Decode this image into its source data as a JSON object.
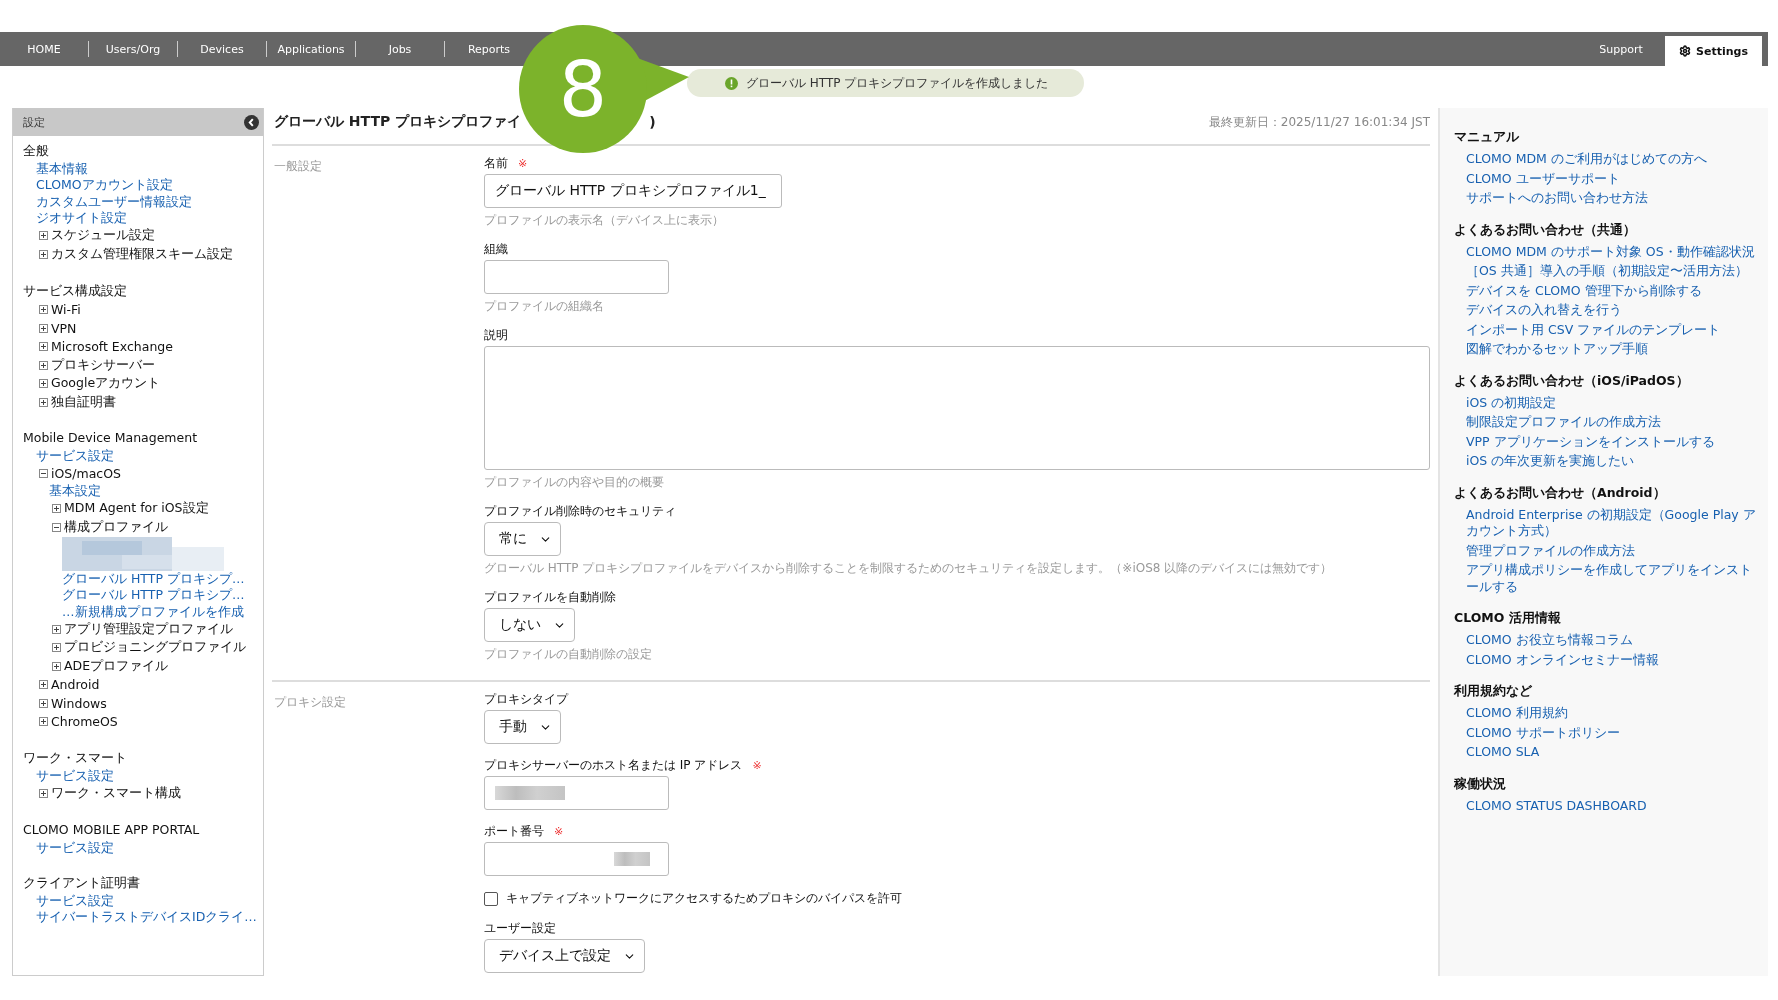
{
  "nav": {
    "tabs": [
      {
        "label": "HOME",
        "selected": false
      },
      {
        "label": "Users/Org",
        "selected": false
      },
      {
        "label": "Devices",
        "selected": false
      },
      {
        "label": "Applications",
        "selected": false
      },
      {
        "label": "Jobs",
        "selected": false
      },
      {
        "label": "Reports",
        "selected": false
      }
    ],
    "right_tabs": [
      {
        "label": "Support",
        "selected": false,
        "kind": "plain"
      },
      {
        "label": "Settings",
        "selected": true,
        "kind": "gear"
      }
    ]
  },
  "step_badge": "8",
  "notification": {
    "kind": "success",
    "text": "グローバル HTTP プロキシプロファイルを作成しました"
  },
  "sidebar": {
    "title": "設定",
    "sections": [
      {
        "heading": "全般",
        "items": [
          {
            "kind": "link",
            "label": "基本情報"
          },
          {
            "kind": "link",
            "label": "CLOMOアカウント設定"
          },
          {
            "kind": "link",
            "label": "カスタムユーザー情報設定"
          },
          {
            "kind": "link",
            "label": "ジオサイト設定"
          },
          {
            "kind": "node",
            "label": "スケジュール設定",
            "expanded": false
          },
          {
            "kind": "node",
            "label": "カスタム管理権限スキーム設定",
            "expanded": false
          }
        ]
      },
      {
        "heading": "サービス構成設定",
        "items": [
          {
            "kind": "node",
            "label": "Wi-Fi",
            "expanded": false
          },
          {
            "kind": "node",
            "label": "VPN",
            "expanded": false
          },
          {
            "kind": "node",
            "label": "Microsoft Exchange",
            "expanded": false
          },
          {
            "kind": "node",
            "label": "プロキシサーバー",
            "expanded": false
          },
          {
            "kind": "node",
            "label": "Googleアカウント",
            "expanded": false
          },
          {
            "kind": "node",
            "label": "独自証明書",
            "expanded": false
          }
        ]
      },
      {
        "heading": "Mobile Device Management",
        "items": [
          {
            "kind": "link",
            "label": "サービス設定"
          },
          {
            "kind": "node",
            "label": "iOS/macOS",
            "expanded": true,
            "children": [
              {
                "kind": "link",
                "label": "基本設定"
              },
              {
                "kind": "node",
                "label": "MDM Agent for iOS設定",
                "expanded": false
              },
              {
                "kind": "node",
                "label": "構成プロファイル",
                "expanded": true,
                "children": [
                  {
                    "kind": "blurred"
                  },
                  {
                    "kind": "link",
                    "label": "グローバル HTTP プロキシプ…"
                  },
                  {
                    "kind": "link",
                    "label": "グローバル HTTP プロキシプ…"
                  },
                  {
                    "kind": "link",
                    "label": "…新規構成プロファイルを作成"
                  }
                ]
              },
              {
                "kind": "node",
                "label": "アプリ管理設定プロファイル",
                "expanded": false
              },
              {
                "kind": "node",
                "label": "プロビジョニングプロファイル",
                "expanded": false
              },
              {
                "kind": "node",
                "label": "ADEプロファイル",
                "expanded": false
              }
            ]
          },
          {
            "kind": "node",
            "label": "Android",
            "expanded": false
          },
          {
            "kind": "node",
            "label": "Windows",
            "expanded": false
          },
          {
            "kind": "node",
            "label": "ChromeOS",
            "expanded": false
          }
        ]
      },
      {
        "heading": "ワーク・スマート",
        "items": [
          {
            "kind": "link",
            "label": "サービス設定"
          },
          {
            "kind": "node",
            "label": "ワーク・スマート構成",
            "expanded": false
          }
        ]
      },
      {
        "heading": "CLOMO MOBILE APP PORTAL",
        "items": [
          {
            "kind": "link",
            "label": "サービス設定"
          }
        ]
      },
      {
        "heading": "クライアント証明書",
        "items": [
          {
            "kind": "link",
            "label": "サービス設定"
          },
          {
            "kind": "link",
            "label": "サイバートラストデバイスIDクライ…"
          }
        ]
      }
    ]
  },
  "main": {
    "title": "グローバル HTTP プロキシプロファイ",
    "title_end": ")",
    "last_updated": "最終更新日：2025/11/27 16:01:34 JST",
    "sections": [
      {
        "label": "一般設定",
        "fields": [
          {
            "kind": "text",
            "label": "名前",
            "required_mark": "※",
            "value": "グローバル HTTP プロキシプロファイル1_",
            "hint": "プロファイルの表示名（デバイス上に表示）"
          },
          {
            "kind": "text",
            "label": "組織",
            "hint": "プロファイルの組織名"
          },
          {
            "kind": "textarea",
            "label": "説明",
            "hint": "プロファイルの内容や目的の概要"
          },
          {
            "kind": "select",
            "label": "プロファイル削除時のセキュリティ",
            "value": "常に",
            "hint": "グローバル HTTP プロキシプロファイルをデバイスから削除することを制限するためのセキュリティを設定します。（※iOS8 以降のデバイスには無効です）"
          },
          {
            "kind": "select",
            "label": "プロファイルを自動削除",
            "value": "しない",
            "hint": "プロファイルの自動削除の設定"
          }
        ]
      },
      {
        "label": "プロキシ設定",
        "fields": [
          {
            "kind": "select",
            "label": "プロキシタイプ",
            "value": "手動"
          },
          {
            "kind": "text",
            "label": "プロキシサーバーのホスト名または IP アドレス",
            "required_mark": "※",
            "blurred": true
          },
          {
            "kind": "number",
            "label": "ポート番号",
            "required_mark": "※",
            "blurred": true
          },
          {
            "kind": "checkbox",
            "label": "キャプティブネットワークにアクセスするためプロキシのバイパスを許可",
            "checked": false
          },
          {
            "kind": "select",
            "label": "ユーザー設定",
            "value": "デバイス上で設定"
          }
        ]
      }
    ]
  },
  "help": {
    "groups": [
      {
        "heading": "マニュアル",
        "links": [
          "CLOMO MDM のご利用がはじめての方へ",
          "CLOMO ユーザーサポート",
          "サポートへのお問い合わせ方法"
        ]
      },
      {
        "heading": "よくあるお問い合わせ（共通）",
        "links": [
          "CLOMO MDM のサポート対象 OS・動作確認状況",
          "［OS 共通］導入の手順（初期設定〜活用方法）",
          "デバイスを CLOMO 管理下から削除する",
          "デバイスの入れ替えを行う",
          "インポート用 CSV ファイルのテンプレート",
          "図解でわかるセットアップ手順"
        ]
      },
      {
        "heading": "よくあるお問い合わせ（iOS/iPadOS）",
        "links": [
          "iOS の初期設定",
          "制限設定プロファイルの作成方法",
          "VPP アプリケーションをインストールする",
          "iOS の年次更新を実施したい"
        ]
      },
      {
        "heading": "よくあるお問い合わせ（Android）",
        "links": [
          "Android Enterprise の初期設定（Google Play アカウント方式）",
          "管理プロファイルの作成方法",
          "アプリ構成ポリシーを作成してアプリをインストールする"
        ]
      },
      {
        "heading": "CLOMO 活用情報",
        "links": [
          "CLOMO お役立ち情報コラム",
          "CLOMO オンラインセミナー情報"
        ]
      },
      {
        "heading": "利用規約など",
        "links": [
          "CLOMO 利用規約",
          "CLOMO サポートポリシー",
          "CLOMO SLA"
        ]
      },
      {
        "heading": "稼働状況",
        "links": [
          "CLOMO STATUS DASHBOARD"
        ]
      }
    ]
  }
}
